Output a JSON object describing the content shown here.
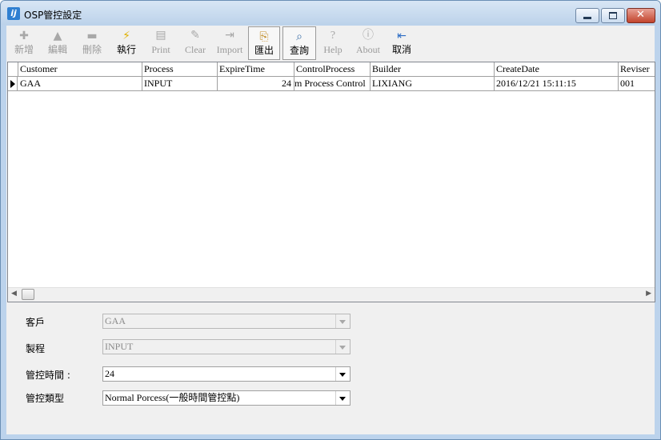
{
  "window": {
    "title": "OSP管控設定"
  },
  "toolbar": {
    "add": "新增",
    "edit": "編輯",
    "delete": "刪除",
    "execute": "執行",
    "print": "Print",
    "clear": "Clear",
    "import": "Import",
    "export": "匯出",
    "query": "查詢",
    "help": "Help",
    "about": "About",
    "cancel": "取消"
  },
  "grid": {
    "columns": [
      "Customer",
      "Process",
      "ExpireTime",
      "ControlProcess",
      "Builder",
      "CreateDate",
      "Reviser"
    ],
    "rows": [
      {
        "customer": "GAA",
        "process": "INPUT",
        "expire_time": "24",
        "control_process": "m Process Control",
        "builder": "LIXIANG",
        "create_date": "2016/12/21 15:11:15",
        "reviser": "001"
      }
    ]
  },
  "form": {
    "customer_label": "客戶",
    "customer_value": "GAA",
    "process_label": "製程",
    "process_value": "INPUT",
    "control_time_label": "管控時間 :",
    "control_time_value": "24",
    "control_type_label": "管控類型",
    "control_type_value": "Normal Porcess(一般時間管控點)"
  },
  "colors": {
    "accent": "#2f7fd1",
    "execute_icon": "#e0b000",
    "close_button": "#c2442c"
  }
}
